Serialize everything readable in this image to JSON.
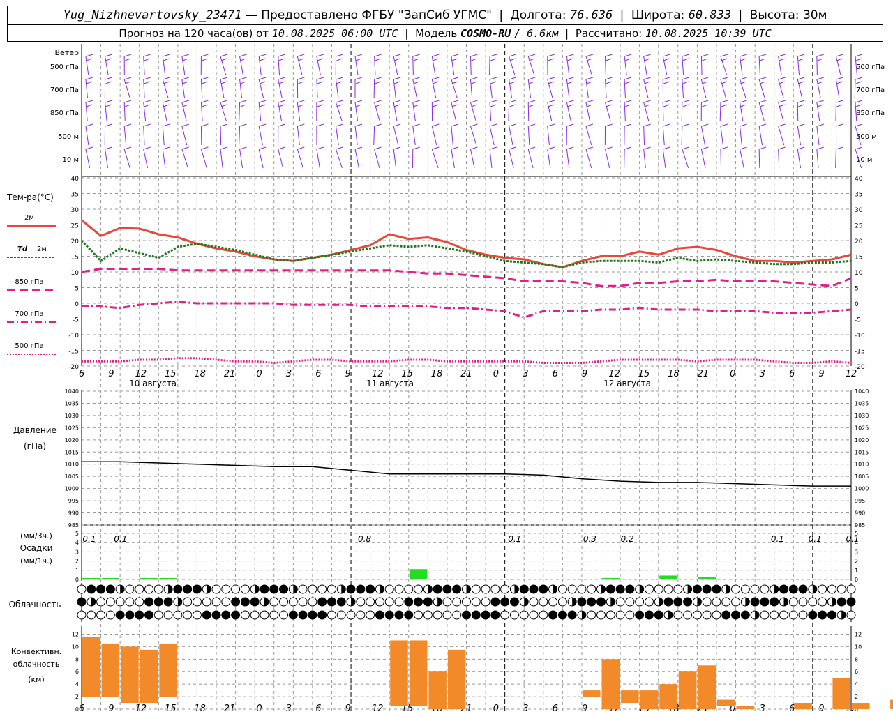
{
  "header": {
    "station": "Yug_Nizhnevartovsky_23471",
    "dash": "—",
    "provided_by": "Предоставлено ФГБУ \"ЗапСиб УГМС\"",
    "lon_label": "Долгота:",
    "lon_value": "76.636",
    "lat_label": "Широта:",
    "lat_value": "60.833",
    "alt_label": "Высота:",
    "alt_value": "30м",
    "forecast_label": "Прогноз на 120 часа(ов) от",
    "forecast_start": "10.08.2025 06:00 UTC",
    "model_label": "Модель",
    "model_name": "COSMO-RU",
    "model_res": "/ 6.6км",
    "calc_label": "Рассчитано:",
    "calc_time": "10.08.2025 10:39 UTC",
    "separator": "|"
  },
  "wind_panel": {
    "title": "Ветер",
    "levels": [
      "500 гПа",
      "700 гПа",
      "850 гПа",
      "500 м",
      "10 м"
    ],
    "barb_color": "#8a2be2"
  },
  "temp_panel": {
    "title": "Тем-ра(°C)",
    "y_ticks": [
      40,
      35,
      30,
      25,
      20,
      15,
      10,
      5,
      0,
      -5,
      -10,
      -15,
      -20
    ],
    "legend": [
      {
        "label": "2м",
        "color": "#e8483a",
        "dash": ""
      },
      {
        "label": "Td",
        "label2": "2м",
        "color": "#1a7a1a",
        "dash": "3,2"
      },
      {
        "label": "850 гПа",
        "color": "#e0208a",
        "dash": "12,6"
      },
      {
        "label": "700 гПа",
        "color": "#e0208a",
        "dash": "10,4,2,4"
      },
      {
        "label": "500 гПа",
        "color": "#e0208a",
        "dash": "2,2"
      }
    ]
  },
  "axis": {
    "hour_labels": [
      "6",
      "9",
      "12",
      "15",
      "18",
      "21",
      "0",
      "3",
      "6",
      "9",
      "12",
      "15",
      "18",
      "21",
      "0",
      "3",
      "6",
      "9",
      "12",
      "15",
      "18",
      "21",
      "0",
      "3",
      "6",
      "9",
      "12"
    ],
    "day_labels": [
      "10 августа",
      "11 августа",
      "12 августа"
    ]
  },
  "pressure_panel": {
    "title": "Давление",
    "unit": "(гПа)",
    "y_ticks": [
      1040,
      1035,
      1030,
      1025,
      1020,
      1015,
      1010,
      1005,
      1000,
      995,
      990,
      985
    ]
  },
  "precip_panel": {
    "unit_top": "(мм/3ч.)",
    "title": "Осадки",
    "unit_bottom": "(мм/1ч.)",
    "y_ticks": [
      5,
      4,
      3,
      2,
      1,
      0
    ]
  },
  "cloud_panel": {
    "title": "Облачность"
  },
  "conv_panel": {
    "title_line1": "Конвективн.",
    "title_line2": "облачность",
    "unit": "(км)",
    "y_ticks": [
      12,
      10,
      8,
      6,
      4,
      2,
      0
    ]
  },
  "chart_data": [
    {
      "type": "line",
      "title": "Тем-ра(°C)",
      "ylim": [
        -20,
        40
      ],
      "x": [
        0,
        3,
        6,
        9,
        12,
        15,
        18,
        21,
        24,
        27,
        30,
        33,
        36,
        39,
        42,
        45,
        48,
        51,
        54,
        57,
        60,
        63,
        66,
        69,
        72,
        75,
        78,
        81,
        84,
        87,
        90,
        93,
        96,
        99,
        102,
        105,
        108,
        111,
        114,
        117,
        120
      ],
      "series": [
        {
          "name": "2м",
          "values": [
            26.5,
            21.5,
            24,
            23.8,
            22,
            21,
            19,
            17.5,
            16.5,
            15,
            14,
            13.5,
            14.5,
            15.5,
            17,
            18.5,
            22,
            20.5,
            21,
            19.5,
            17,
            15.5,
            14.5,
            14,
            12.5,
            11.5,
            13.5,
            15,
            15,
            16.5,
            15.5,
            17.5,
            18,
            17,
            15,
            13.5,
            13.5,
            13,
            13.5,
            14,
            15.5
          ]
        },
        {
          "name": "Td 2м",
          "values": [
            20,
            13.5,
            17.5,
            16,
            14.5,
            18,
            19,
            18,
            17,
            15.5,
            14,
            13.5,
            14.5,
            15.5,
            16.5,
            17.5,
            18.5,
            18,
            18.5,
            17.5,
            16.5,
            15,
            13.5,
            13,
            12.5,
            11.5,
            13,
            13.5,
            13.5,
            13.5,
            13,
            14.5,
            13.5,
            14,
            13.5,
            13,
            12.5,
            12.5,
            13,
            13,
            13.5
          ]
        },
        {
          "name": "850 гПа",
          "values": [
            10,
            11,
            11,
            11,
            11,
            10.5,
            10.5,
            10.5,
            10.5,
            10.5,
            10.5,
            10.5,
            10.5,
            10.5,
            10.5,
            10.5,
            10.5,
            10,
            9.5,
            9.5,
            9,
            8.5,
            8,
            7,
            7,
            7,
            6.5,
            5.5,
            5.5,
            6.5,
            6.5,
            7,
            7,
            7.5,
            7,
            7,
            7,
            6.5,
            6,
            5.5,
            8
          ]
        },
        {
          "name": "700 гПа",
          "values": [
            -1,
            -1,
            -1.5,
            -0.5,
            0,
            0.5,
            0,
            0,
            0,
            0,
            0,
            -0.5,
            -0.5,
            -0.5,
            -0.5,
            -1,
            -1,
            -1,
            -1,
            -1.5,
            -1.5,
            -2,
            -2.5,
            -4.5,
            -2.5,
            -2.5,
            -2.5,
            -2,
            -2,
            -1.5,
            -2,
            -2,
            -2,
            -2.5,
            -2.5,
            -2.5,
            -3,
            -3,
            -3,
            -2.5,
            -2
          ]
        },
        {
          "name": "500 гПа",
          "values": [
            -18.5,
            -18.5,
            -18.5,
            -18,
            -18,
            -17.5,
            -17.5,
            -18,
            -18.5,
            -18.5,
            -19,
            -18.5,
            -18,
            -18,
            -18.5,
            -18.5,
            -18.5,
            -18,
            -18,
            -18.5,
            -18.5,
            -18.5,
            -18.5,
            -18.5,
            -19,
            -19,
            -19,
            -18.5,
            -18,
            -18,
            -18,
            -18,
            -18.5,
            -18,
            -18,
            -18,
            -18.5,
            -19,
            -19,
            -18.5,
            -19
          ]
        }
      ]
    },
    {
      "type": "line",
      "title": "Давление",
      "ylim": [
        985,
        1040
      ],
      "x": [
        0,
        6,
        12,
        18,
        24,
        30,
        36,
        42,
        48,
        54,
        60,
        66,
        72,
        78,
        84,
        90,
        96,
        102,
        108,
        114,
        120
      ],
      "series": [
        {
          "name": "Давление",
          "values": [
            1011,
            1011,
            1010.5,
            1010,
            1009.5,
            1009,
            1009,
            1007.5,
            1006,
            1006,
            1006,
            1006,
            1005.5,
            1004,
            1003,
            1002.5,
            1002.5,
            1002,
            1001.5,
            1001,
            1001
          ]
        }
      ]
    },
    {
      "type": "bar",
      "title": "Осадки",
      "ylim": [
        0,
        5
      ],
      "x": [
        0,
        3,
        6,
        9,
        12,
        15,
        18,
        21,
        24,
        27,
        30,
        33,
        36,
        39,
        42,
        45,
        48,
        51,
        54,
        57,
        60,
        63,
        66,
        69,
        72,
        75,
        78,
        81,
        84,
        87,
        90,
        93,
        96,
        99,
        102,
        105,
        108,
        111,
        114,
        117,
        120
      ],
      "values": [
        0.1,
        0.1,
        0,
        0.1,
        0.1,
        0,
        0,
        0,
        0,
        0,
        0,
        0,
        0,
        0,
        0,
        0,
        0,
        0.8,
        0,
        0,
        0,
        0,
        0,
        0,
        0,
        0,
        0,
        0.1,
        0,
        0,
        0.3,
        0,
        0.2,
        0,
        0,
        0,
        0,
        0,
        0,
        0,
        0
      ],
      "annotations": [
        "0.1",
        "0.1",
        "0.8",
        "0.1",
        "0.3",
        "0.2",
        "0.1",
        "0.1",
        "0.1"
      ],
      "annotation_hours": [
        1,
        6,
        45,
        69,
        81,
        87,
        111,
        117,
        123
      ]
    },
    {
      "type": "bar",
      "title": "Конвективн. облачность",
      "ylim": [
        0,
        12
      ],
      "x": [
        0,
        3,
        6,
        9,
        12,
        15,
        18,
        21,
        24,
        27,
        30,
        33,
        36,
        39,
        42,
        45,
        48,
        51,
        54,
        57,
        60,
        63,
        66,
        69,
        72,
        75,
        78,
        81,
        84,
        87,
        90,
        93,
        96,
        99,
        102,
        105,
        108,
        111,
        114,
        117,
        120
      ],
      "values": [
        9.5,
        8.5,
        9,
        8.5,
        8.5,
        0,
        0,
        0,
        0,
        0,
        0,
        0,
        0,
        0,
        0,
        0,
        10.5,
        10.5,
        6,
        9.5,
        0,
        0,
        0,
        0,
        0,
        0,
        1,
        8,
        2,
        3,
        4,
        6,
        7,
        1,
        0.5,
        0,
        0,
        1,
        0,
        5,
        1,
        0,
        1.5,
        5,
        5,
        5,
        5,
        4,
        5
      ]
    }
  ]
}
